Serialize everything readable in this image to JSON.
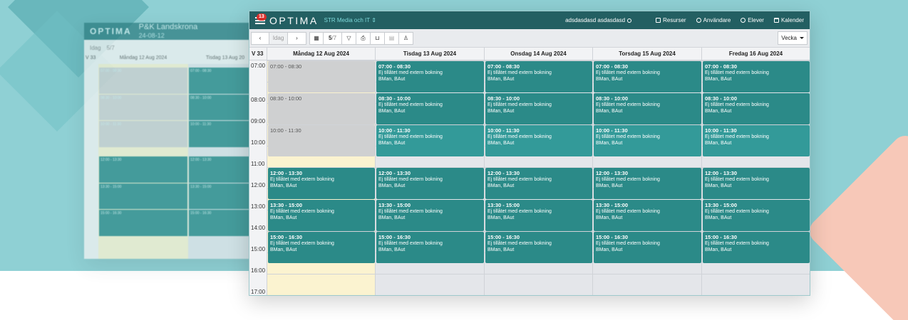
{
  "background_colors": {
    "teal": "#8fd0d4",
    "peach": "#f7c8b8"
  },
  "ghost": {
    "brand": "OPTIMA",
    "org": "P&K Landskrona",
    "date": "24-08-12",
    "today": "Idag",
    "page": "5/7",
    "week": "V 33",
    "cols": [
      "Måndag 12 Aug 2024",
      "Tisdag 13 Aug 20"
    ]
  },
  "app": {
    "notification_count": "13",
    "brand": "OPTIMA",
    "org_selector": "STR Media och IT",
    "user": "adsdasdasd asdasdasd",
    "nav": [
      {
        "label": "Resurser",
        "icon": "box-icon"
      },
      {
        "label": "Användare",
        "icon": "user-icon"
      },
      {
        "label": "Elever",
        "icon": "users-icon"
      },
      {
        "label": "Kalender",
        "icon": "calendar-icon"
      }
    ],
    "colors": {
      "topbar": "#235f62",
      "event": "#2b8a88",
      "event_highlight": "#339a99",
      "event_gray": "#cfd0d1",
      "today_col": "#fbf3d0",
      "badge": "#d9302c"
    }
  },
  "toolbar": {
    "today_label": "Idag",
    "page_current": "5",
    "page_total": "/7",
    "view_selector": "Vecka"
  },
  "calendar": {
    "week_label": "V 33",
    "days": [
      "Måndag 12 Aug 2024",
      "Tisdag 13 Aug 2024",
      "Onsdag 14 Aug 2024",
      "Torsdag 15 Aug 2024",
      "Fredag 16 Aug 2024"
    ],
    "hours": [
      "07:00",
      "08:00",
      "09:00",
      "10:00",
      "11:00",
      "12:00",
      "13:00",
      "14:00",
      "15:00",
      "16:00",
      "17:00"
    ],
    "slots": [
      {
        "time": "07:00 - 08:30"
      },
      {
        "time": "08:30 - 10:00"
      },
      {
        "time": "10:00 - 11:30"
      },
      {
        "time": "12:00 - 13:30"
      },
      {
        "time": "13:30 - 15:00"
      },
      {
        "time": "15:00 - 16:30"
      }
    ],
    "event_text": "Ej tillåtet med extern bokning",
    "event_people": "BMan, BAut"
  }
}
